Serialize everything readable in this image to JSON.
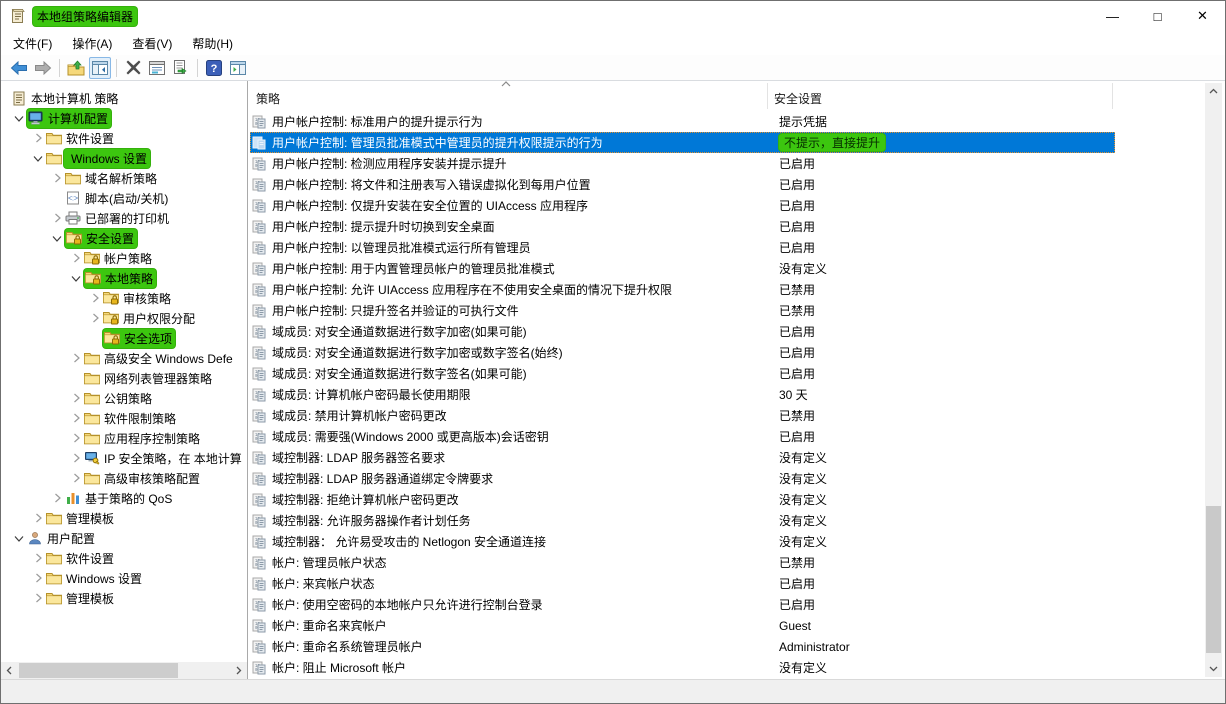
{
  "window": {
    "title": "本地组策略编辑器",
    "title_highlighted": true,
    "controls": {
      "minimize": "—",
      "maximize": "□",
      "close": "✕"
    }
  },
  "menubar": {
    "items": [
      "文件(F)",
      "操作(A)",
      "查看(V)",
      "帮助(H)"
    ]
  },
  "toolbar": {
    "groups": [
      [
        "back",
        "forward"
      ],
      [
        "up-one-level",
        "show-console-tree"
      ],
      [
        "delete",
        "properties",
        "export-list"
      ],
      [
        "help",
        "show-action-pane"
      ]
    ],
    "pressed": "show-console-tree"
  },
  "tree": {
    "items": [
      {
        "label": "本地计算机 策略",
        "level": 0,
        "chevron": "none",
        "icon": "scroll",
        "highlight": null
      },
      {
        "label": "计算机配置",
        "level": 1,
        "chevron": "expanded",
        "icon": "computer",
        "highlight": "icon-label"
      },
      {
        "label": "软件设置",
        "level": 2,
        "chevron": "collapsed",
        "icon": "folder",
        "highlight": null
      },
      {
        "label": "Windows 设置",
        "level": 2,
        "chevron": "expanded",
        "icon": "folder",
        "highlight": "label"
      },
      {
        "label": "域名解析策略",
        "level": 3,
        "chevron": "collapsed",
        "icon": "folder",
        "highlight": null
      },
      {
        "label": "脚本(启动/关机)",
        "level": 3,
        "chevron": "none",
        "icon": "script",
        "highlight": null
      },
      {
        "label": "已部署的打印机",
        "level": 3,
        "chevron": "collapsed",
        "icon": "printer",
        "highlight": null
      },
      {
        "label": "安全设置",
        "level": 3,
        "chevron": "expanded",
        "icon": "folder-lock",
        "highlight": "icon-label"
      },
      {
        "label": "帐户策略",
        "level": 4,
        "chevron": "collapsed",
        "icon": "folder-lock",
        "highlight": null
      },
      {
        "label": "本地策略",
        "level": 4,
        "chevron": "expanded",
        "icon": "folder-lock",
        "highlight": "icon-label"
      },
      {
        "label": "审核策略",
        "level": 5,
        "chevron": "collapsed",
        "icon": "folder-lock",
        "highlight": null
      },
      {
        "label": "用户权限分配",
        "level": 5,
        "chevron": "collapsed",
        "icon": "folder-lock",
        "highlight": null
      },
      {
        "label": "安全选项",
        "level": 5,
        "chevron": "none",
        "icon": "folder-lock",
        "highlight": "icon-label"
      },
      {
        "label": "高级安全 Windows Defe",
        "level": 4,
        "chevron": "collapsed",
        "icon": "folder",
        "highlight": null
      },
      {
        "label": "网络列表管理器策略",
        "level": 4,
        "chevron": "none",
        "icon": "folder",
        "highlight": null
      },
      {
        "label": "公钥策略",
        "level": 4,
        "chevron": "collapsed",
        "icon": "folder",
        "highlight": null
      },
      {
        "label": "软件限制策略",
        "level": 4,
        "chevron": "collapsed",
        "icon": "folder",
        "highlight": null
      },
      {
        "label": "应用程序控制策略",
        "level": 4,
        "chevron": "collapsed",
        "icon": "folder",
        "highlight": null
      },
      {
        "label": "IP 安全策略，在 本地计算",
        "level": 4,
        "chevron": "collapsed",
        "icon": "ipsec",
        "highlight": null
      },
      {
        "label": "高级审核策略配置",
        "level": 4,
        "chevron": "collapsed",
        "icon": "folder",
        "highlight": null
      },
      {
        "label": "基于策略的 QoS",
        "level": 3,
        "chevron": "collapsed",
        "icon": "chart",
        "highlight": null
      },
      {
        "label": "管理模板",
        "level": 2,
        "chevron": "collapsed",
        "icon": "folder",
        "highlight": null
      },
      {
        "label": "用户配置",
        "level": 1,
        "chevron": "expanded",
        "icon": "user",
        "highlight": null
      },
      {
        "label": "软件设置",
        "level": 2,
        "chevron": "collapsed",
        "icon": "folder",
        "highlight": null
      },
      {
        "label": "Windows 设置",
        "level": 2,
        "chevron": "collapsed",
        "icon": "folder",
        "highlight": null
      },
      {
        "label": "管理模板",
        "level": 2,
        "chevron": "collapsed",
        "icon": "folder",
        "highlight": null
      }
    ]
  },
  "list": {
    "columns": {
      "policy": "策略",
      "setting": "安全设置",
      "sort": "asc"
    },
    "selected_index": 1,
    "value_highlight_index": 1,
    "rows": [
      {
        "policy": "用户帐户控制: 标准用户的提升提示行为",
        "setting": "提示凭据"
      },
      {
        "policy": "用户帐户控制: 管理员批准模式中管理员的提升权限提示的行为",
        "setting": "不提示，直接提升"
      },
      {
        "policy": "用户帐户控制: 检测应用程序安装并提示提升",
        "setting": "已启用"
      },
      {
        "policy": "用户帐户控制: 将文件和注册表写入错误虚拟化到每用户位置",
        "setting": "已启用"
      },
      {
        "policy": "用户帐户控制: 仅提升安装在安全位置的 UIAccess 应用程序",
        "setting": "已启用"
      },
      {
        "policy": "用户帐户控制: 提示提升时切换到安全桌面",
        "setting": "已启用"
      },
      {
        "policy": "用户帐户控制: 以管理员批准模式运行所有管理员",
        "setting": "已启用"
      },
      {
        "policy": "用户帐户控制: 用于内置管理员帐户的管理员批准模式",
        "setting": "没有定义"
      },
      {
        "policy": "用户帐户控制: 允许 UIAccess 应用程序在不使用安全桌面的情况下提升权限",
        "setting": "已禁用"
      },
      {
        "policy": "用户帐户控制: 只提升签名并验证的可执行文件",
        "setting": "已禁用"
      },
      {
        "policy": "域成员: 对安全通道数据进行数字加密(如果可能)",
        "setting": "已启用"
      },
      {
        "policy": "域成员: 对安全通道数据进行数字加密或数字签名(始终)",
        "setting": "已启用"
      },
      {
        "policy": "域成员: 对安全通道数据进行数字签名(如果可能)",
        "setting": "已启用"
      },
      {
        "policy": "域成员: 计算机帐户密码最长使用期限",
        "setting": "30 天"
      },
      {
        "policy": "域成员: 禁用计算机帐户密码更改",
        "setting": "已禁用"
      },
      {
        "policy": "域成员: 需要强(Windows 2000 或更高版本)会话密钥",
        "setting": "已启用"
      },
      {
        "policy": "域控制器: LDAP 服务器签名要求",
        "setting": "没有定义"
      },
      {
        "policy": "域控制器: LDAP 服务器通道绑定令牌要求",
        "setting": "没有定义"
      },
      {
        "policy": "域控制器: 拒绝计算机帐户密码更改",
        "setting": "没有定义"
      },
      {
        "policy": "域控制器: 允许服务器操作者计划任务",
        "setting": "没有定义"
      },
      {
        "policy": "域控制器： 允许易受攻击的 Netlogon 安全通道连接",
        "setting": "没有定义"
      },
      {
        "policy": "帐户: 管理员帐户状态",
        "setting": "已禁用"
      },
      {
        "policy": "帐户: 来宾帐户状态",
        "setting": "已启用"
      },
      {
        "policy": "帐户: 使用空密码的本地帐户只允许进行控制台登录",
        "setting": "已启用"
      },
      {
        "policy": "帐户: 重命名来宾帐户",
        "setting": "Guest"
      },
      {
        "policy": "帐户: 重命名系统管理员帐户",
        "setting": "Administrator"
      },
      {
        "policy": "帐户: 阻止 Microsoft 帐户",
        "setting": "没有定义"
      }
    ]
  },
  "colors": {
    "accent_selection": "#0078d7",
    "marker_green": "#3cc60f",
    "selected_text": "#ffffff",
    "scrollbar_track": "#f0f0f0",
    "scrollbar_thumb": "#c9c9c9"
  }
}
